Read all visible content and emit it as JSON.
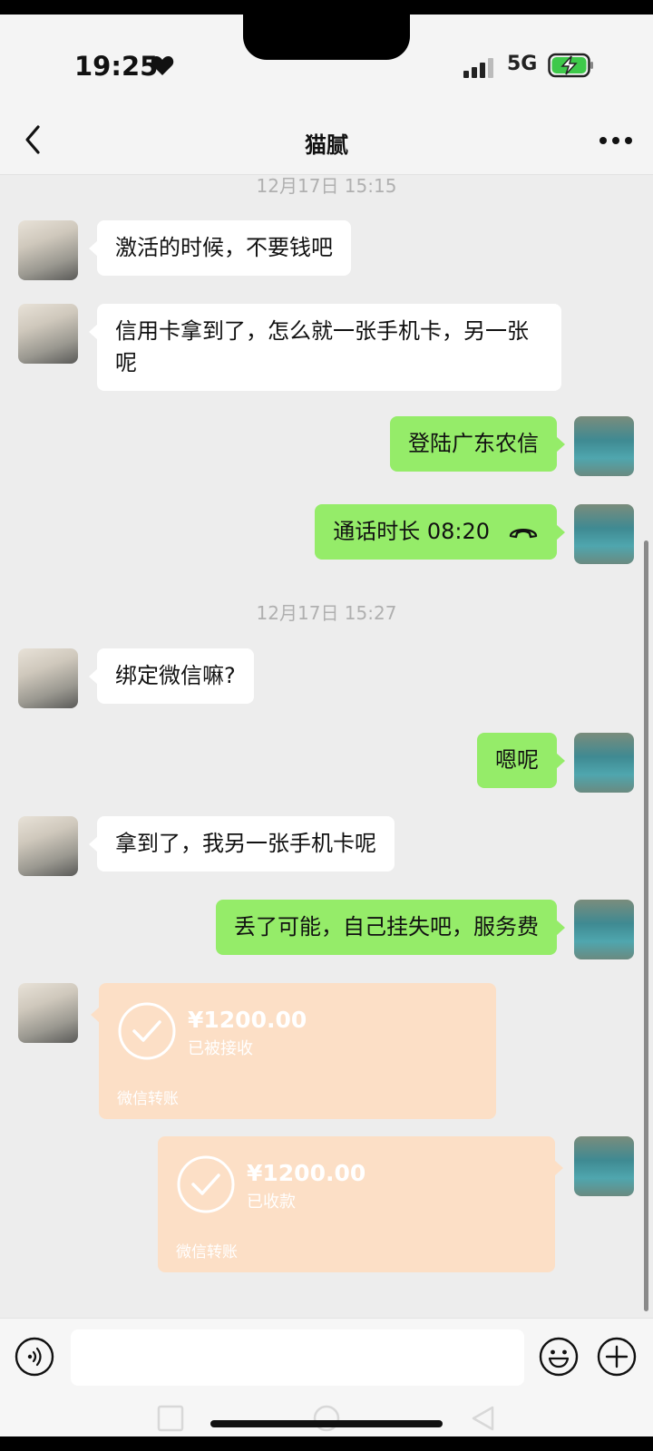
{
  "status_bar": {
    "time": "19:25",
    "network": "5G",
    "heart_icon": "heart-icon",
    "signal_icon": "signal-icon",
    "battery_icon": "battery-charging-icon"
  },
  "nav": {
    "title": "猫腻",
    "back_icon": "chevron-left-icon",
    "more_icon": "more-dots-icon"
  },
  "timestamps": [
    "12月17日 15:15",
    "12月17日 15:27"
  ],
  "messages": [
    {
      "side": "left",
      "text": "激活的时候，不要钱吧"
    },
    {
      "side": "left",
      "text": "信用卡拿到了，怎么就一张手机卡，另一张呢"
    },
    {
      "side": "right",
      "text": "登陆广东农信"
    },
    {
      "side": "right",
      "text": "通话时长 08:20",
      "icon": "phone-hangup-icon"
    },
    {
      "side": "left",
      "text": "绑定微信嘛?"
    },
    {
      "side": "right",
      "text": "嗯呢"
    },
    {
      "side": "left",
      "text": "拿到了，我另一张手机卡呢"
    },
    {
      "side": "right",
      "text": "丢了可能，自己挂失吧，服务费"
    }
  ],
  "transfers": [
    {
      "side": "left",
      "amount": "¥1200.00",
      "status": "已被接收",
      "label": "微信转账"
    },
    {
      "side": "right",
      "amount": "¥1200.00",
      "status": "已收款",
      "label": "微信转账"
    }
  ],
  "input_bar": {
    "voice_icon": "voice-icon",
    "emoji_icon": "emoji-icon",
    "plus_icon": "plus-icon",
    "placeholder": ""
  },
  "colors": {
    "chat_bg": "#ededed",
    "bubble_mine": "#95ec69",
    "bubble_theirs": "#ffffff",
    "transfer_bg": "#fcdfc6"
  }
}
